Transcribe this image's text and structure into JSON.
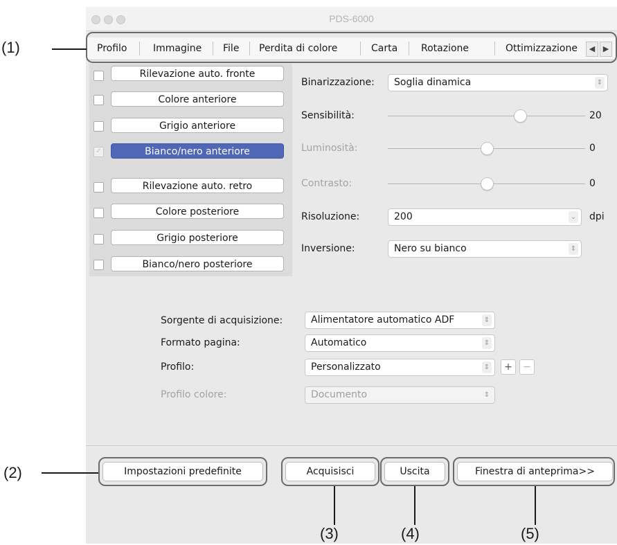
{
  "window": {
    "title": "PDS-6000"
  },
  "tabs": [
    "Profilo",
    "Immagine",
    "File",
    "Perdita di colore",
    "Carta",
    "Rotazione",
    "Ottimizzazione"
  ],
  "tab_scroll": {
    "left": "◀",
    "right": "▶"
  },
  "image_modes": [
    {
      "label": "Rilevazione auto. fronte",
      "checked": false,
      "selected": false
    },
    {
      "label": "Colore anteriore",
      "checked": false,
      "selected": false
    },
    {
      "label": "Grigio anteriore",
      "checked": false,
      "selected": false
    },
    {
      "label": "Bianco/nero anteriore",
      "checked": true,
      "selected": true
    },
    {
      "label": "Rilevazione auto. retro",
      "checked": false,
      "selected": false
    },
    {
      "label": "Colore posteriore",
      "checked": false,
      "selected": false
    },
    {
      "label": "Grigio posteriore",
      "checked": false,
      "selected": false
    },
    {
      "label": "Bianco/nero posteriore",
      "checked": false,
      "selected": false
    }
  ],
  "checkmark": "✓",
  "settings": {
    "binarizzazione": {
      "label": "Binarizzazione:",
      "value": "Soglia dinamica"
    },
    "sensibilita": {
      "label": "Sensibilità:",
      "value": "20",
      "level": 0.67
    },
    "luminosita": {
      "label": "Luminosità:",
      "value": "0",
      "level": 0.5
    },
    "contrasto": {
      "label": "Contrasto:",
      "value": "0",
      "level": 0.5
    },
    "risoluzione": {
      "label": "Risoluzione:",
      "value": "200",
      "unit": "dpi"
    },
    "inversione": {
      "label": "Inversione:",
      "value": "Nero su bianco"
    }
  },
  "source": {
    "sorgente": {
      "label": "Sorgente di acquisizione:",
      "value": "Alimentatore automatico ADF"
    },
    "formato": {
      "label": "Formato pagina:",
      "value": "Automatico"
    },
    "profilo": {
      "label": "Profilo:",
      "value": "Personalizzato",
      "add": "+",
      "remove": "−"
    },
    "profilo_colore": {
      "label": "Profilo colore:",
      "value": "Documento"
    }
  },
  "buttons": {
    "defaults": "Impostazioni predefinite",
    "acquire": "Acquisisci",
    "exit": "Uscita",
    "preview": "Finestra di anteprima>>"
  },
  "callouts": {
    "c1": "(1)",
    "c2": "(2)",
    "c3": "(3)",
    "c4": "(4)",
    "c5": "(5)"
  },
  "icons": {
    "stepper": "updown-arrows-icon",
    "traffic": "window-control-icon"
  },
  "colors": {
    "selected": "#4f67b6",
    "window_bg": "#e9e9e9"
  }
}
